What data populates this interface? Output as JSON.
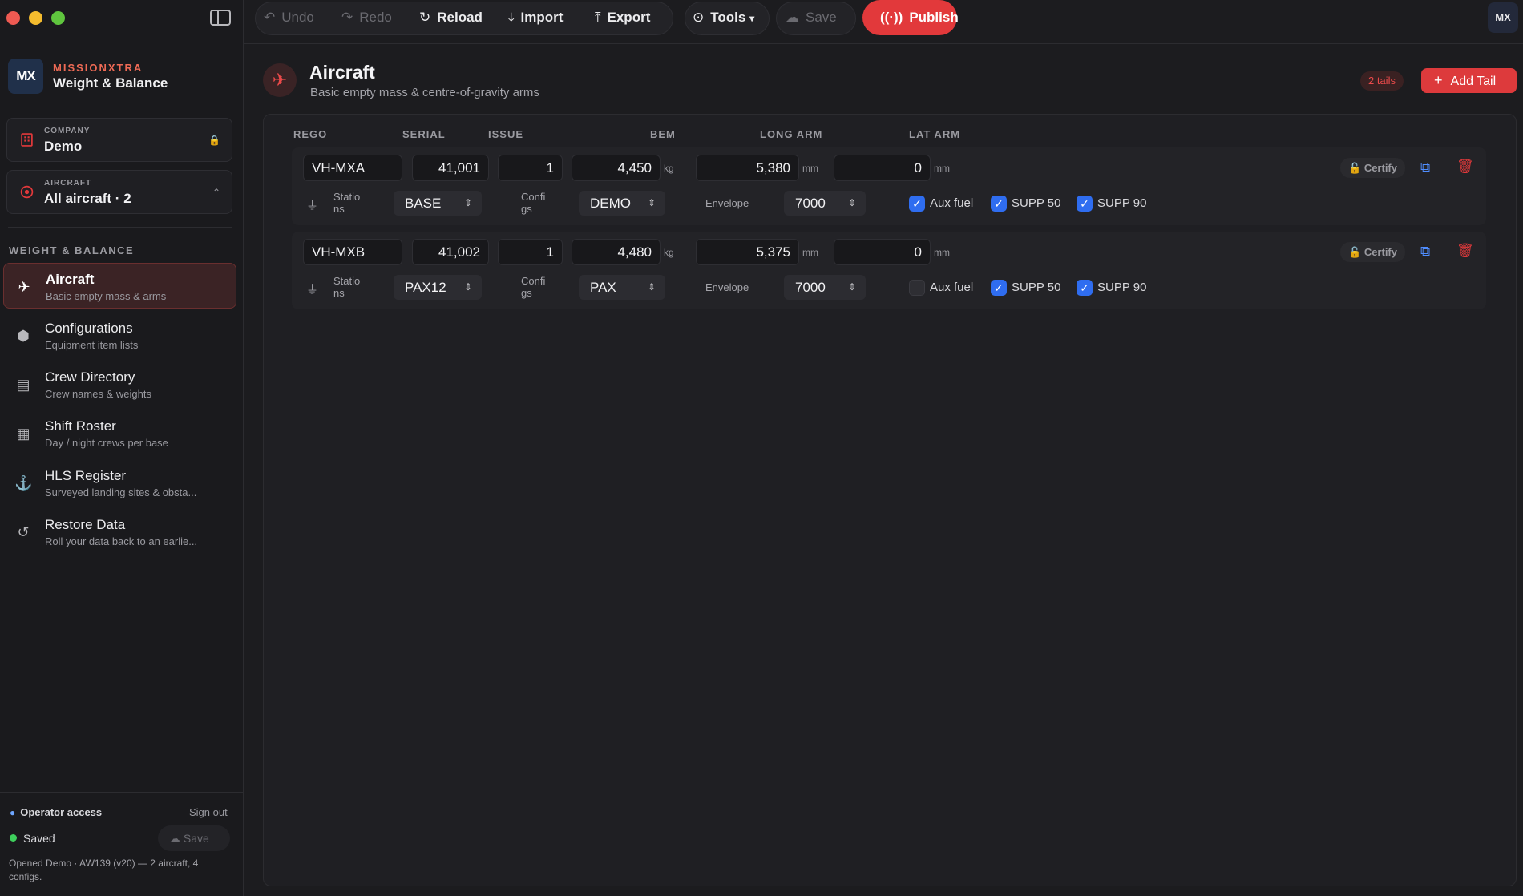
{
  "brand": {
    "logo": "MX",
    "name": "MISSIONXTRA",
    "product": "Weight & Balance"
  },
  "company": {
    "label": "COMPANY",
    "value": "Demo",
    "icon": "building-icon",
    "lock_icon": "lock-icon"
  },
  "aircraft_picker": {
    "label": "AIRCRAFT",
    "value": "All aircraft  ·  2",
    "icon": "target-icon"
  },
  "sidebar": {
    "section": "WEIGHT & BALANCE",
    "items": [
      {
        "title": "Aircraft",
        "subtitle": "Basic empty mass & arms",
        "icon": "plane-icon",
        "active": true
      },
      {
        "title": "Configurations",
        "subtitle": "Equipment item lists",
        "icon": "box-icon"
      },
      {
        "title": "Crew Directory",
        "subtitle": "Crew names & weights",
        "icon": "id-card-icon"
      },
      {
        "title": "Shift Roster",
        "subtitle": "Day / night crews per base",
        "icon": "calendar-clock-icon"
      },
      {
        "title": "HLS Register",
        "subtitle": "Surveyed landing sites & obsta...",
        "icon": "anchor-icon"
      },
      {
        "title": "Restore Data",
        "subtitle": "Roll your data back to an earlie...",
        "icon": "history-icon"
      }
    ],
    "footer": {
      "operator": "Operator access",
      "sign_out": "Sign out",
      "status": "Saved",
      "save": "Save",
      "opened": "Opened Demo · AW139 (v20) — 2 aircraft, 4 configs."
    }
  },
  "toolbar": {
    "undo": "Undo",
    "redo": "Redo",
    "reload": "Reload",
    "import": "Import",
    "export": "Export",
    "tools": "Tools",
    "save": "Save",
    "publish": "Publish",
    "avatar": "MX"
  },
  "page": {
    "title": "Aircraft",
    "subtitle": "Basic empty mass & centre-of-gravity arms",
    "count_badge": "2 tails",
    "add_button": "Add Tail"
  },
  "columns": [
    "REGO",
    "SERIAL",
    "ISSUE",
    "BEM",
    "LONG ARM",
    "LAT ARM"
  ],
  "labels": {
    "stations": "Statio ns",
    "configs": "Confi gs",
    "envelope": "Envelope",
    "kg": "kg",
    "mm": "mm",
    "certify": "Certify"
  },
  "aircraft": [
    {
      "rego": "VH-MXA",
      "serial": "41,001",
      "issue": "1",
      "bem": "4,450",
      "long_arm": "5,380",
      "lat_arm": "0",
      "station": "BASE",
      "config": "DEMO",
      "envelope": "7000",
      "options": [
        {
          "label": "Aux fuel",
          "checked": true
        },
        {
          "label": "SUPP 50",
          "checked": true
        },
        {
          "label": "SUPP 90",
          "checked": true
        }
      ]
    },
    {
      "rego": "VH-MXB",
      "serial": "41,002",
      "issue": "1",
      "bem": "4,480",
      "long_arm": "5,375",
      "lat_arm": "0",
      "station": "PAX12",
      "config": "PAX",
      "envelope": "7000",
      "options": [
        {
          "label": "Aux fuel",
          "checked": false
        },
        {
          "label": "SUPP 50",
          "checked": true
        },
        {
          "label": "SUPP 90",
          "checked": true
        }
      ]
    }
  ],
  "colors": {
    "accent": "#e2393b",
    "checkbox": "#2f6df0",
    "saved": "#3ecf5c"
  }
}
